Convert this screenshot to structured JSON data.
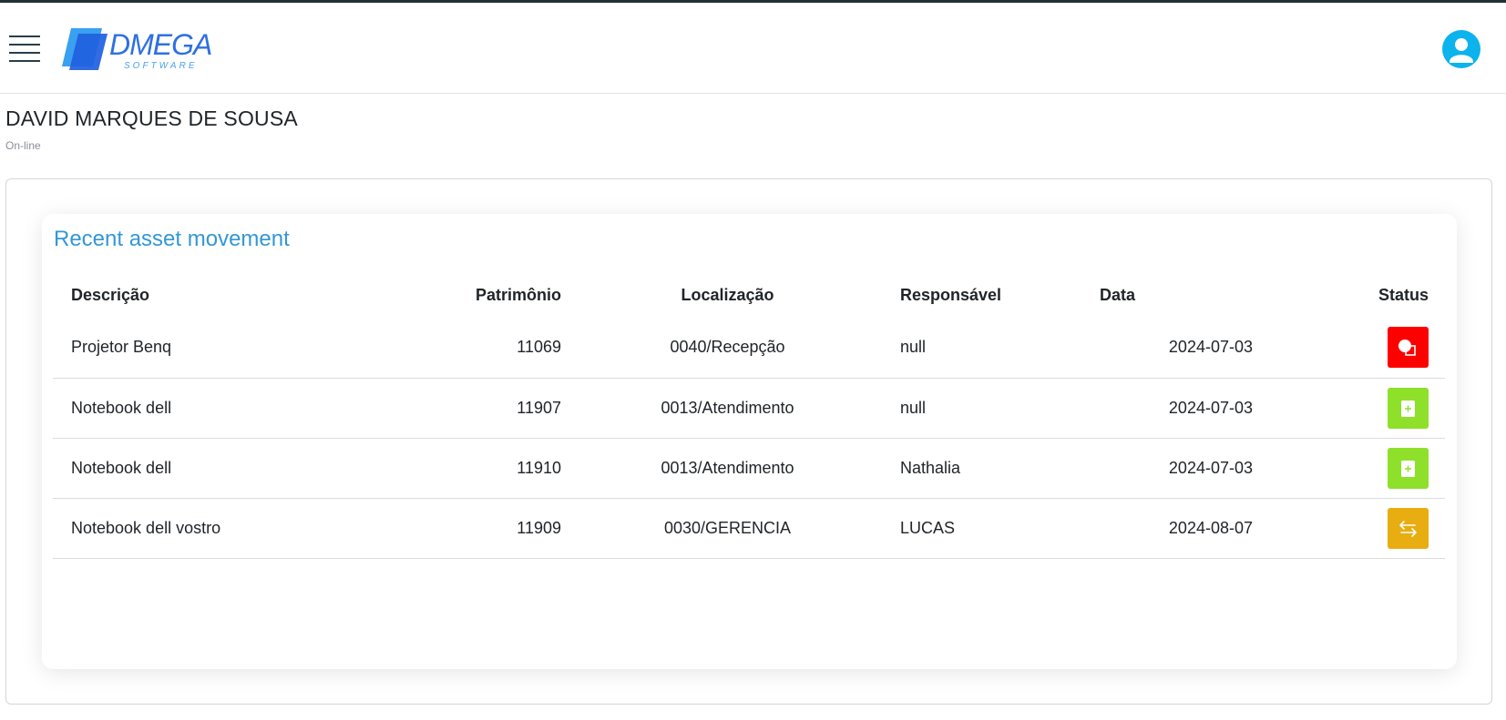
{
  "header": {
    "logo": {
      "brand": "DMEGA",
      "sub": "SOFTWARE"
    },
    "menu_icon": "hamburger-menu-icon",
    "user_icon": "user-circle-icon"
  },
  "page": {
    "title": "DAVID MARQUES DE SOUSA",
    "subtitle": "On-line"
  },
  "card": {
    "title": "Recent asset movement",
    "columns": {
      "descricao": "Descrição",
      "patrimonio": "Patrimônio",
      "localizacao": "Localização",
      "responsavel": "Responsável",
      "data": "Data",
      "status": "Status"
    },
    "rows": [
      {
        "descricao": "Projetor Benq",
        "patrimonio": "11069",
        "localizacao": "0040/Recepção",
        "responsavel": "null",
        "data": "2024-07-03",
        "status_color": "#ff0000",
        "status_icon": "shapes-icon"
      },
      {
        "descricao": "Notebook dell",
        "patrimonio": "11907",
        "localizacao": "0013/Atendimento",
        "responsavel": "null",
        "data": "2024-07-03",
        "status_color": "#8ee02a",
        "status_icon": "file-plus-icon"
      },
      {
        "descricao": "Notebook dell",
        "patrimonio": "11910",
        "localizacao": "0013/Atendimento",
        "responsavel": "Nathalia",
        "data": "2024-07-03",
        "status_color": "#8ee02a",
        "status_icon": "file-plus-icon"
      },
      {
        "descricao": "Notebook dell vostro",
        "patrimonio": "11909",
        "localizacao": "0030/GERENCIA",
        "responsavel": "LUCAS",
        "data": "2024-08-07",
        "status_color": "#e8ad10",
        "status_icon": "transfer-arrows-icon"
      }
    ]
  },
  "colors": {
    "accent": "#3397d7",
    "user_icon_bg": "#0cb3ec",
    "logo_blue": "#2f6fe3"
  }
}
